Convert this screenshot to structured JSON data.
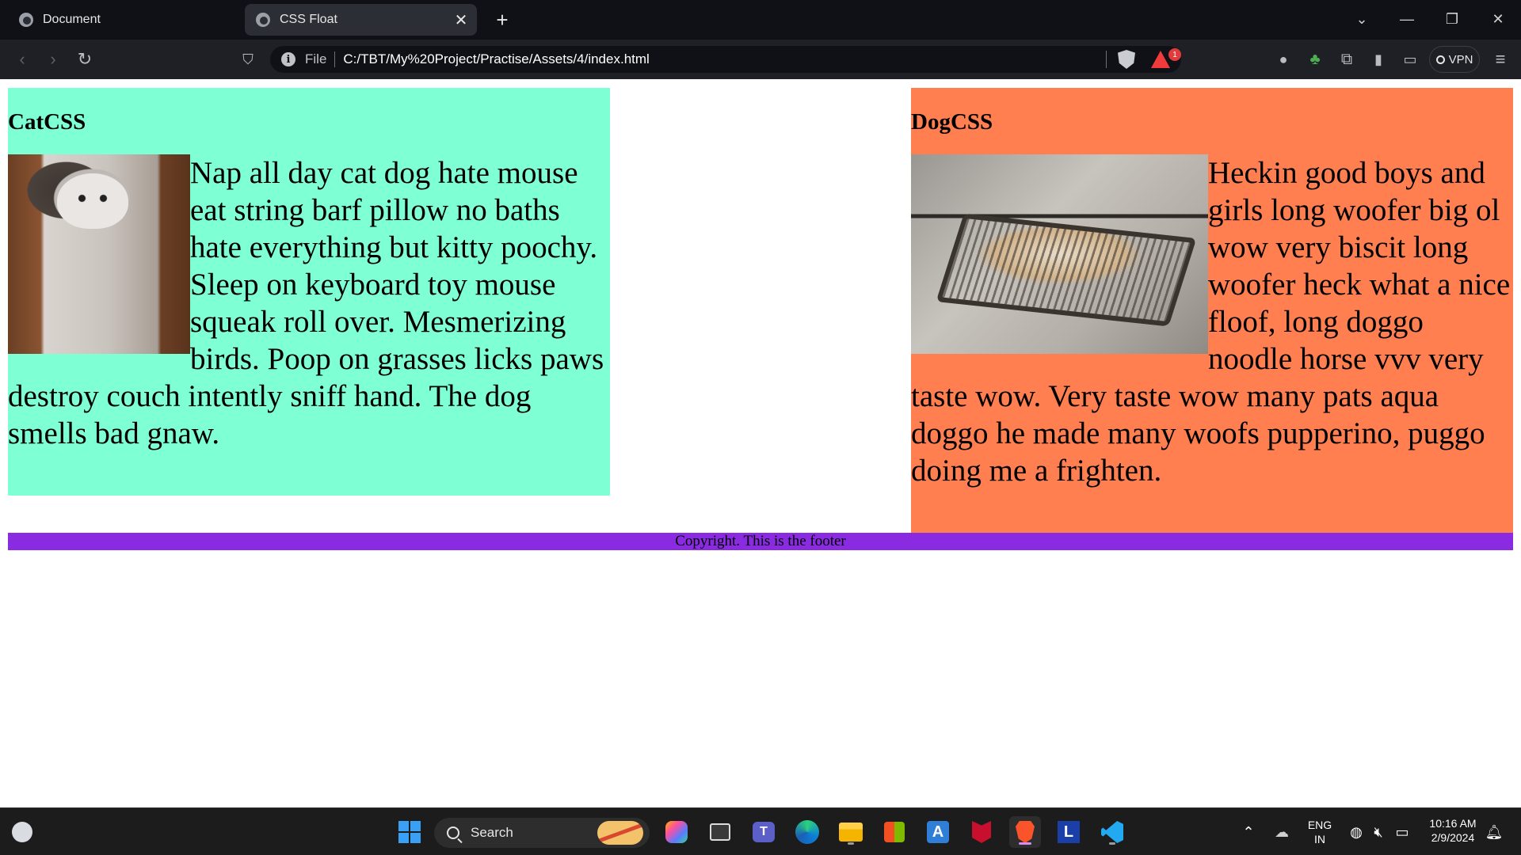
{
  "browser": {
    "tabs": [
      {
        "title": "Document",
        "active": false
      },
      {
        "title": "CSS Float",
        "active": true
      }
    ],
    "new_tab_symbol": "+",
    "address": {
      "scheme_label": "File",
      "url": "C:/TBT/My%20Project/Practise/Assets/4/index.html"
    },
    "rewards_badge": "1",
    "vpn_label": "VPN"
  },
  "page": {
    "cat": {
      "heading": "CatCSS",
      "text": "Nap all day cat dog hate mouse eat string barf pillow no baths hate everything but kitty poochy. Sleep on keyboard toy mouse squeak roll over. Mesmerizing birds. Poop on grasses licks paws destroy couch intently sniff hand. The dog smells bad gnaw.",
      "bg_color": "#7fffd4"
    },
    "dog": {
      "heading": "DogCSS",
      "text": "Heckin good boys and girls long woofer big ol wow very biscit long woofer heck what a nice floof, long doggo noodle horse vvv very taste wow. Very taste wow many pats aqua doggo he made many woofs pupperino, puggo doing me a frighten.",
      "bg_color": "#ff7f50"
    },
    "footer": {
      "text": "Copyright. This is the footer",
      "bg_color": "#8a2be2"
    }
  },
  "taskbar": {
    "search_label": "Search",
    "language": {
      "line1": "ENG",
      "line2": "IN"
    },
    "clock": {
      "time": "10:16 AM",
      "date": "2/9/2024"
    },
    "apps": [
      "weather-icon",
      "start-icon",
      "search-icon",
      "copilot-icon",
      "task-view-icon",
      "teams-icon",
      "edge-icon",
      "file-explorer-icon",
      "store-icon",
      "autodesk-icon",
      "mcafee-icon",
      "brave-icon",
      "l-app-icon",
      "vscode-icon"
    ]
  }
}
